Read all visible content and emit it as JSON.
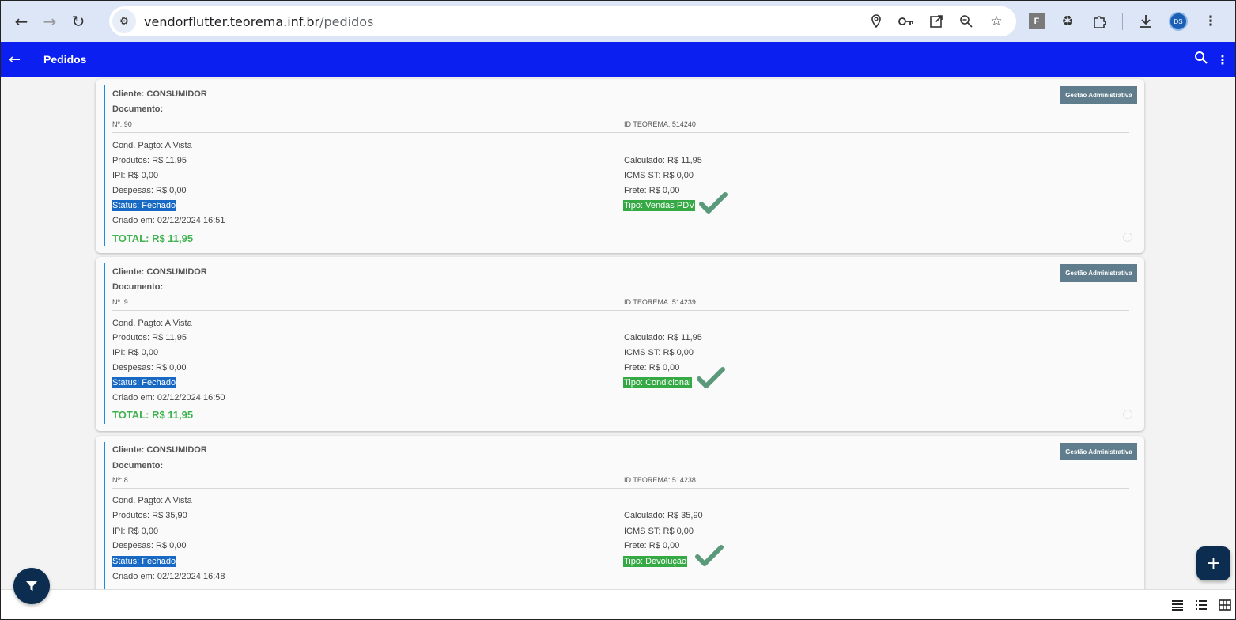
{
  "browser": {
    "url_host": "vendorflutter.teorema.inf.br",
    "url_path": "/pedidos",
    "icons": [
      "location-icon",
      "key-icon",
      "open-external-icon",
      "zoom-icon",
      "star-icon"
    ],
    "ext_f_label": "F",
    "avatar_label": "DS"
  },
  "appbar": {
    "title": "Pedidos"
  },
  "orders": [
    {
      "cliente": "Cliente: CONSUMIDOR",
      "documento": "Documento:",
      "badge": "Gestão Administrativa",
      "numero": "Nº: 90",
      "id_teorema": "ID TEOREMA: 514240",
      "cond_pagto": "Cond. Pagto:  A Vista",
      "produtos": "Produtos: R$ 11,95",
      "calculado": "Calculado: R$ 11,95",
      "ipi": "IPI: R$ 0,00",
      "icms_st": "ICMS ST: R$ 0,00",
      "despesas": "Despesas: R$ 0,00",
      "frete": "Frete: R$ 0,00",
      "status": "Status: Fechado",
      "tipo": "Tipo: Vendas PDV",
      "criado": "Criado em: 02/12/2024 16:51",
      "total": "TOTAL: R$ 11,95"
    },
    {
      "cliente": "Cliente: CONSUMIDOR",
      "documento": "Documento:",
      "badge": "Gestão Administrativa",
      "numero": "Nº: 9",
      "id_teorema": "ID TEOREMA: 514239",
      "cond_pagto": "Cond. Pagto:  A Vista",
      "produtos": "Produtos: R$ 11,95",
      "calculado": "Calculado: R$ 11,95",
      "ipi": "IPI: R$ 0,00",
      "icms_st": "ICMS ST: R$ 0,00",
      "despesas": "Despesas: R$ 0,00",
      "frete": "Frete: R$ 0,00",
      "status": "Status: Fechado",
      "tipo": "Tipo: Condicional",
      "criado": "Criado em: 02/12/2024 16:50",
      "total": "TOTAL: R$ 11,95"
    },
    {
      "cliente": "Cliente: CONSUMIDOR",
      "documento": "Documento:",
      "badge": "Gestão Administrativa",
      "numero": "Nº: 8",
      "id_teorema": "ID TEOREMA: 514238",
      "cond_pagto": "Cond. Pagto:  A Vista",
      "produtos": "Produtos: R$ 35,90",
      "calculado": "Calculado: R$ 35,90",
      "ipi": "IPI: R$ 0,00",
      "icms_st": "ICMS ST: R$ 0,00",
      "despesas": "Despesas: R$ 0,00",
      "frete": "Frete: R$ 0,00",
      "status": "Status: Fechado",
      "tipo": "Tipo: Devolução",
      "criado": "Criado em: 02/12/2024 16:48",
      "total": ""
    }
  ],
  "fab": {
    "add_label": "+"
  },
  "colors": {
    "appbar": "#0a1ff0",
    "status_bg": "#1769c4",
    "tipo_bg": "#35a944",
    "total_text": "#3fb34f",
    "check": "#5a9a7a",
    "fab_bg": "#0c2d50"
  }
}
